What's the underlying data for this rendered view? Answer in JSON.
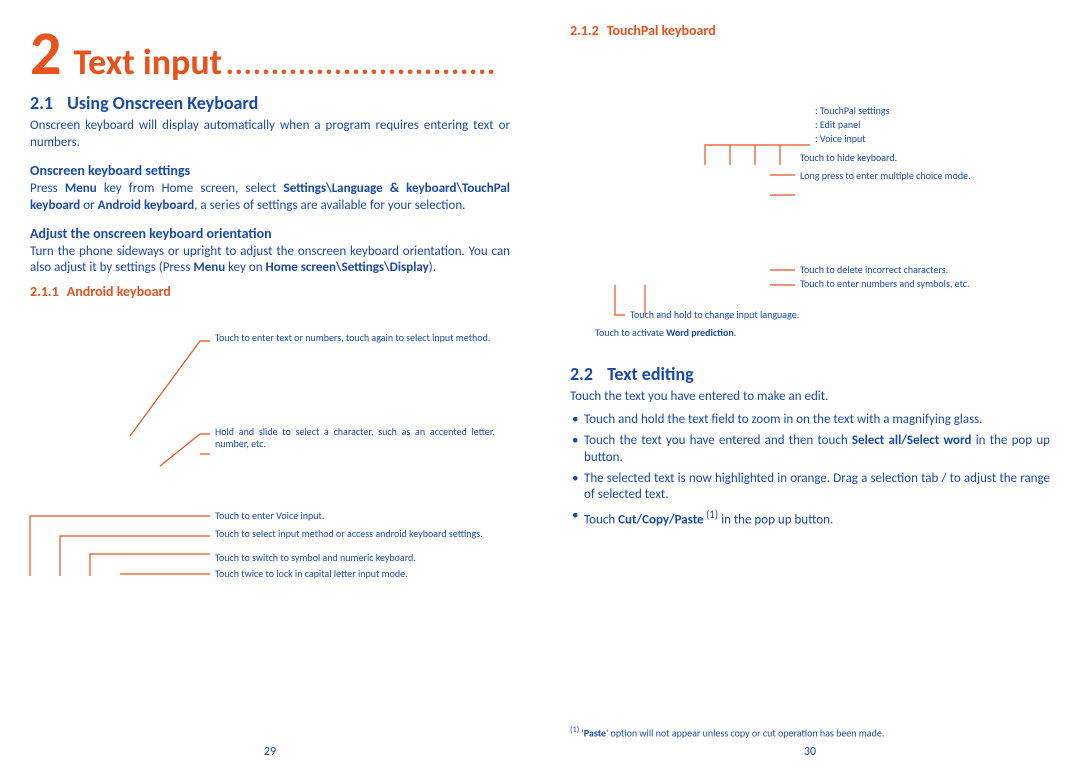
{
  "colors": {
    "accent": "#e8521c",
    "body": "#1a4ba8"
  },
  "left": {
    "chapter_num": "2",
    "chapter_title": "Text input",
    "dots": "..............................",
    "s21_num": "2.1",
    "s21_title": "Using Onscreen Keyboard",
    "s21_body": "Onscreen keyboard will display automatically when a program requires entering text or numbers.",
    "sub1_title": "Onscreen keyboard settings",
    "sub1_prefix": "Press ",
    "sub1_b1": "Menu",
    "sub1_mid1": " key from Home screen, select ",
    "sub1_b2": "Settings\\Language & keyboard\\TouchPal keyboard",
    "sub1_mid2": " or ",
    "sub1_b3": "Android keyboard",
    "sub1_suffix": ", a series of settings are available for your selection.",
    "sub2_title": "Adjust the onscreen keyboard orientation",
    "sub2_prefix": "Turn the phone sideways or upright to adjust the onscreen keyboard orientation. You can also adjust it by settings (Press ",
    "sub2_b1": "Menu",
    "sub2_mid1": " key on ",
    "sub2_b2": "Home screen\\Settings\\Display",
    "sub2_suffix": ").",
    "s211_num": "2.1.1",
    "s211_title": "Android keyboard",
    "ann1": "Touch to enter text or numbers, touch again to select input method.",
    "ann2": "Hold and slide to select a character, such as an accented letter, number, etc.",
    "ann3": "Touch to enter Voice input.",
    "ann4": "Touch to select input method or access android keyboard settings.",
    "ann5": "Touch to switch to symbol and numeric keyboard.",
    "ann6": "Touch twice to lock in capital letter input mode.",
    "page_num": "29"
  },
  "right": {
    "s212_num": "2.1.2",
    "s212_title": "TouchPal keyboard",
    "a1": ": TouchPal settings",
    "a2": ": Edit panel",
    "a3": ": Voice input",
    "a4": "Touch to hide keyboard.",
    "a5": "Long press to enter multiple choice mode.",
    "a6": "Touch to delete incorrect characters.",
    "a7": "Touch to enter numbers and symbols, etc.",
    "a8": "Touch and hold to change input language.",
    "a9_pre": "Touch to activate ",
    "a9_b": "Word prediction",
    "a9_post": ".",
    "s22_num": "2.2",
    "s22_title": "Text editing",
    "s22_intro": "Touch the text you have entered to make an edit.",
    "b1": "Touch and hold the text field to zoom in on the text with a magnifying glass.",
    "b2_pre": "Touch the text you have entered and then touch ",
    "b2_b": "Select all/Select word",
    "b2_post": " in the pop up button.",
    "b3": "The selected text is now highlighted in orange. Drag a selection tab    / to adjust the range of selected text.",
    "b4_pre": "Touch ",
    "b4_b": "Cut/Copy/Paste",
    "b4_sup": " (1)",
    "b4_post": " in the pop up button.",
    "fn_sup": "(1)",
    "fn_pre": "  '",
    "fn_b": "Paste",
    "fn_post": "' option will not appear unless copy or cut operation has been made.",
    "page_num": "30"
  }
}
